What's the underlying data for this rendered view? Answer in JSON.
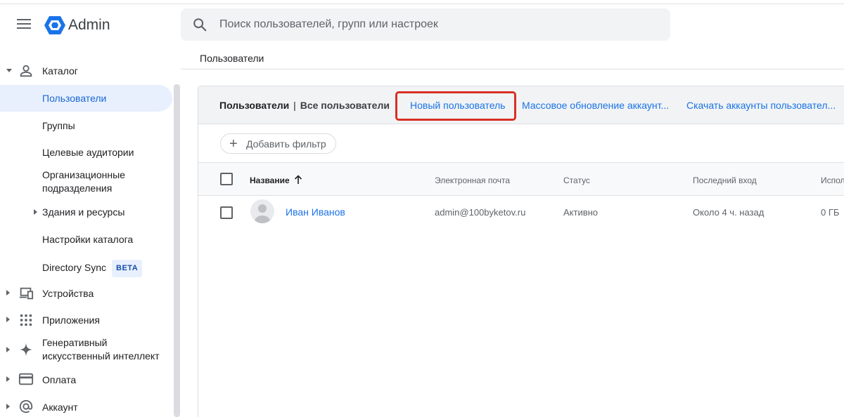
{
  "app": {
    "title": "Admin"
  },
  "search": {
    "placeholder": "Поиск пользователей, групп или настроек"
  },
  "breadcrumb": "Пользователи",
  "sidebar": {
    "items": [
      {
        "label": "Каталог",
        "icon": "person-icon"
      },
      {
        "label": "Пользователи"
      },
      {
        "label": "Группы"
      },
      {
        "label": "Целевые аудитории"
      },
      {
        "label": "Организационные подразделения"
      },
      {
        "label": "Здания и ресурсы"
      },
      {
        "label": "Настройки каталога"
      },
      {
        "label": "Directory Sync",
        "badge": "BETA"
      },
      {
        "label": "Устройства",
        "icon": "devices-icon"
      },
      {
        "label": "Приложения",
        "icon": "apps-grid-icon"
      },
      {
        "label": "Генеративный искусственный интеллект",
        "icon": "sparkle-icon"
      },
      {
        "label": "Оплата",
        "icon": "credit-card-icon"
      },
      {
        "label": "Аккаунт",
        "icon": "at-sign-icon"
      }
    ]
  },
  "card": {
    "title": "Пользователи",
    "separator": "|",
    "subtitle": "Все пользователи",
    "actions": {
      "new_user": "Новый пользователь",
      "bulk_update": "Массовое обновление аккаунт...",
      "download": "Скачать аккаунты пользовател..."
    },
    "filter_label": "Добавить фильтр",
    "columns": {
      "name": "Название",
      "email": "Электронная почта",
      "status": "Статус",
      "last_login": "Последний вход",
      "usage": "Испол"
    },
    "rows": [
      {
        "name": "Иван Иванов",
        "email": "admin@100byketov.ru",
        "status": "Активно",
        "last_login": "Около 4 ч. назад",
        "usage": "0 ГБ"
      }
    ]
  },
  "colors": {
    "accent": "#1a73e8",
    "highlight": "#d93025",
    "active_bg": "#e8f0fe"
  }
}
